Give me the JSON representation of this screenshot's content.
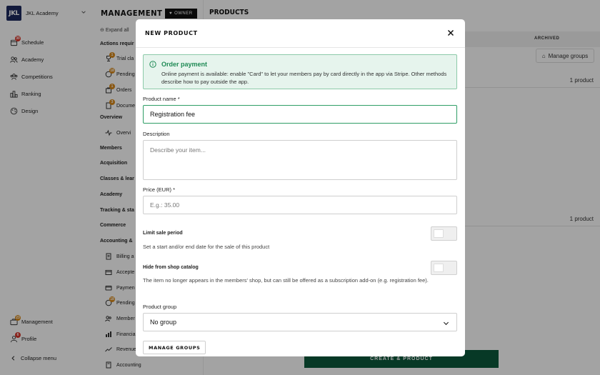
{
  "app": {
    "logo_text": "JKL",
    "org_name": "JKL Academy",
    "nav": [
      {
        "label": "Schedule",
        "icon": "calendar-icon",
        "badge": "30"
      },
      {
        "label": "Academy",
        "icon": "users-icon",
        "badge": ""
      },
      {
        "label": "Competitions",
        "icon": "users-group-icon",
        "badge": ""
      },
      {
        "label": "Ranking",
        "icon": "ranking-icon",
        "badge": ""
      },
      {
        "label": "Design",
        "icon": "palette-icon",
        "badge": ""
      }
    ],
    "bottom_nav": [
      {
        "label": "Management",
        "icon": "briefcase-icon",
        "badge": "23"
      },
      {
        "label": "Profile",
        "icon": "person-icon",
        "badge": "6"
      }
    ],
    "collapse_label": "Collapse menu"
  },
  "sub_sidebar": {
    "expand_all": "Expand all",
    "sections": [
      "Actions requir",
      "Overview",
      "Members",
      "Acquisition",
      "Classes & lear",
      "Academy",
      "Tracking & sta",
      "Commerce",
      "Accounting & "
    ],
    "items": [
      {
        "label": "Trial cla",
        "badge": "1"
      },
      {
        "label": "Pending",
        "badge": "18"
      },
      {
        "label": "Orders",
        "badge": "1"
      },
      {
        "label": "Docume",
        "badge": "3"
      },
      {
        "label": "Overvi",
        "badge": ""
      },
      {
        "label": "Billing a",
        "badge": ""
      },
      {
        "label": "Accepte",
        "badge": ""
      },
      {
        "label": "Paymen",
        "badge": ""
      },
      {
        "label": "Pending",
        "badge": "18"
      },
      {
        "label": "Member",
        "badge": ""
      },
      {
        "label": "Financia",
        "badge": ""
      },
      {
        "label": "Revenue",
        "badge": ""
      },
      {
        "label": "Accounting",
        "badge": ""
      }
    ]
  },
  "header": {
    "title": "MANAGEMENT",
    "role_badge": "OWNER",
    "tab": "PRODUCTS"
  },
  "main": {
    "archived_col": "ARCHIVED",
    "manage_groups": "Manage groups",
    "group_counts": [
      "1 product",
      "1 product"
    ],
    "create_button": "CREATE & PRODUCT"
  },
  "modal": {
    "title": "NEW PRODUCT",
    "alert": {
      "title": "Order payment",
      "text": "Online payment is available: enable \"Card\" to let your members pay by card directly in the app via Stripe. Other methods describe how to pay outside the app."
    },
    "product_name": {
      "label": "Product name *",
      "value": "Registration fee"
    },
    "description": {
      "label": "Description",
      "placeholder": "Describe your item..."
    },
    "price": {
      "label": "Price (EUR) *",
      "placeholder": "E.g.: 35.00"
    },
    "limit_sale": {
      "label": "Limit sale period",
      "hint": "Set a start and/or end date for the sale of this product",
      "enabled": false
    },
    "hide_catalog": {
      "label": "Hide from shop catalog",
      "hint": "The item no longer appears in the members' shop, but can still be offered as a subscription add-on (e.g. registration fee).",
      "enabled": false
    },
    "product_group": {
      "label": "Product group",
      "value": "No group"
    },
    "manage_groups_button": "MANAGE GROUPS"
  },
  "colors": {
    "brand": "#1d2a5e",
    "accent_green": "#1f8a55",
    "alert_bg": "#e6f4ed",
    "badge_red": "#d9362b",
    "create_button": "#0c5a3c"
  }
}
